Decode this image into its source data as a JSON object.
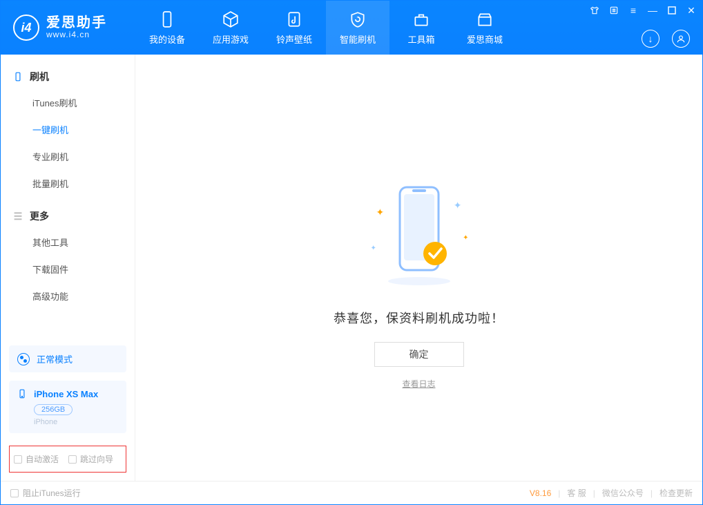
{
  "app": {
    "name": "爱思助手",
    "site": "www.i4.cn"
  },
  "nav": {
    "items": [
      {
        "label": "我的设备"
      },
      {
        "label": "应用游戏"
      },
      {
        "label": "铃声壁纸"
      },
      {
        "label": "智能刷机"
      },
      {
        "label": "工具箱"
      },
      {
        "label": "爱思商城"
      }
    ]
  },
  "sidebar": {
    "group1": {
      "title": "刷机"
    },
    "items1": [
      {
        "label": "iTunes刷机"
      },
      {
        "label": "一键刷机"
      },
      {
        "label": "专业刷机"
      },
      {
        "label": "批量刷机"
      }
    ],
    "group2": {
      "title": "更多"
    },
    "items2": [
      {
        "label": "其他工具"
      },
      {
        "label": "下载固件"
      },
      {
        "label": "高级功能"
      }
    ],
    "status": "正常模式",
    "device": {
      "name": "iPhone XS Max",
      "storage": "256GB",
      "type": "iPhone"
    },
    "checks": {
      "auto_activate": "自动激活",
      "skip_guide": "跳过向导"
    }
  },
  "main": {
    "success_msg": "恭喜您，保资料刷机成功啦！",
    "ok": "确定",
    "log_link": "查看日志"
  },
  "footer": {
    "block_itunes": "阻止iTunes运行",
    "version": "V8.16",
    "support": "客 服",
    "wechat": "微信公众号",
    "update": "检查更新"
  }
}
